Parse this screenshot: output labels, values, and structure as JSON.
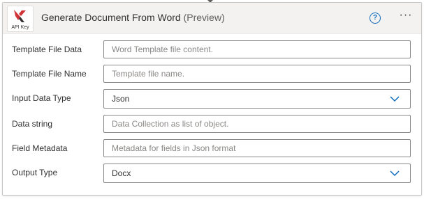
{
  "card": {
    "logo_text": "API Key",
    "title": "Generate Document From Word",
    "title_suffix": "(Preview)",
    "help_glyph": "?",
    "more_glyph": "···"
  },
  "fields": {
    "template_file_data": {
      "label": "Template File Data",
      "placeholder": "Word Template file content."
    },
    "template_file_name": {
      "label": "Template File Name",
      "placeholder": "Template file name."
    },
    "input_data_type": {
      "label": "Input Data Type",
      "value": "Json"
    },
    "data_string": {
      "label": "Data string",
      "placeholder": "Data Collection as list of object."
    },
    "field_metadata": {
      "label": "Field Metadata",
      "placeholder": "Metadata for fields in Json format"
    },
    "output_type": {
      "label": "Output Type",
      "value": "Docx"
    }
  },
  "icons": {
    "logo": "api-key-logo-icon",
    "help": "help-icon",
    "more": "more-options-icon",
    "dropdown": "chevron-down-icon"
  },
  "colors": {
    "accent": "#0f6cbd",
    "logo_red": "#d13438",
    "logo_dark": "#323130"
  }
}
